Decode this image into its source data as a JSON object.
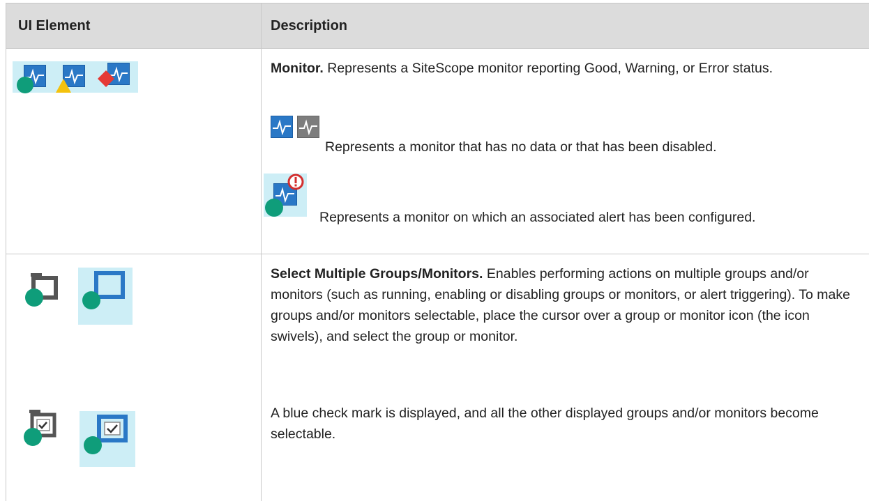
{
  "table": {
    "headers": {
      "ui_element": "UI Element",
      "description": "Description"
    },
    "rows": [
      {
        "title": "Monitor.",
        "text": " Represents a SiteScope monitor reporting Good, Warning, or Error status.",
        "extra1": "Represents a monitor that has no data or that has been disabled.",
        "extra2": "Represents a monitor on which an associated alert has been configured.",
        "icons": [
          "monitor-good-icon",
          "monitor-warning-icon",
          "monitor-error-icon",
          "monitor-no-data-icon",
          "monitor-disabled-icon",
          "monitor-alert-icon"
        ]
      },
      {
        "title": "Select Multiple Groups/Monitors.",
        "text": " Enables performing actions on multiple groups and/or monitors (such as running, enabling or disabling groups or monitors, or alert triggering). To make groups and/or monitors selectable, place the cursor over a group or monitor icon (the icon swivels), and select the group or monitor.",
        "extra1": "A blue check mark is displayed, and all the other displayed groups and/or monitors become selectable.",
        "icons": [
          "group-icon",
          "monitor-swivel-icon",
          "group-selected-icon",
          "monitor-selected-icon"
        ]
      }
    ]
  },
  "colors": {
    "header_bg": "#dcdcdc",
    "monitor_blue": "#2a78c6",
    "good_green": "#0f9d7a",
    "warning_yellow": "#f4c20d",
    "error_red": "#e53935",
    "alert_red": "#d32f2f"
  }
}
